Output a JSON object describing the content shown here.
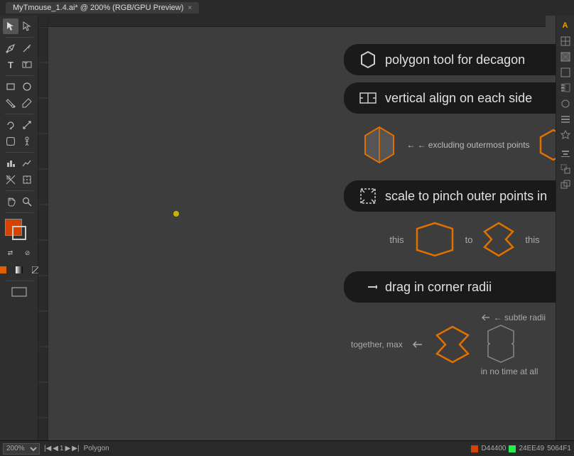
{
  "titlebar": {
    "tab_label": "MyTmouse_1.4.ai* @ 200% (RGB/GPU Preview)",
    "close_icon": "×"
  },
  "toolbar": {
    "tools": [
      "↖",
      "⌀",
      "✏",
      "✂",
      "T",
      "⬜",
      "✱",
      "⟳",
      "☁",
      "📐",
      "🔲",
      "⬛",
      "⊞",
      "✦",
      "☷",
      "♦",
      "↕",
      "↔",
      "⊙",
      "🔍",
      "✋",
      "🔍",
      "⬜",
      "⬛"
    ]
  },
  "canvas": {
    "zoom": "200%",
    "color_mode": "RGB/GPU Preview"
  },
  "bottom_bar": {
    "zoom_value": "200%",
    "nav_page": "1",
    "artboard_name": "Polygon",
    "x_coord": "5064F1",
    "color1": "D44400",
    "color2": "24EE49"
  },
  "instructions": {
    "card1": {
      "label": "polygon tool for decagon",
      "icon": "hexagon"
    },
    "card2": {
      "label": "vertical align on each side",
      "icon": "align"
    },
    "diagram1": {
      "arrow_text": "← excluding outermost points"
    },
    "card3": {
      "label": "scale to pinch outer points in",
      "icon": "scale"
    },
    "diagram2": {
      "this_left": "this",
      "to_text": "to",
      "this_right": "this"
    },
    "card4": {
      "label": "drag in corner radii",
      "icon": "arrow"
    },
    "diagram3": {
      "together_max": "together, max",
      "subtle_radii": "← subtle radii",
      "in_no_time": "in no time at all"
    }
  },
  "right_panel": {
    "icons": [
      "A",
      "⊞",
      "■",
      "⬜",
      "▦",
      "☁",
      "☷",
      "⬡",
      "?"
    ]
  }
}
